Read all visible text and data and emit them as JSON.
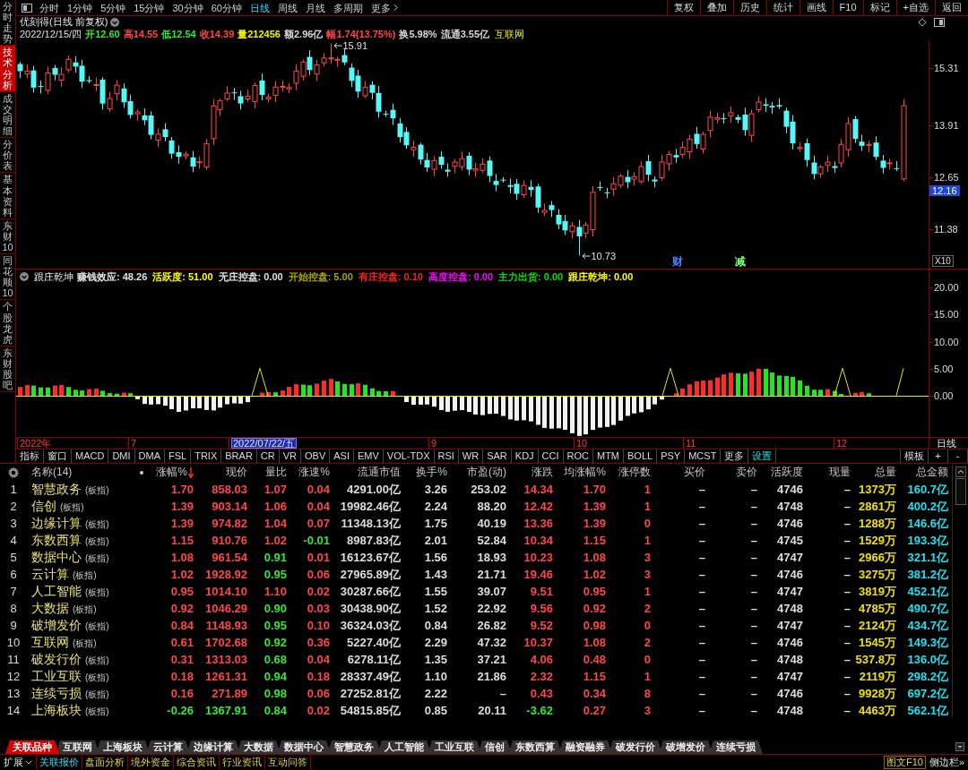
{
  "sidebar": {
    "tabs": [
      {
        "label": "分时走势",
        "selected": false
      },
      {
        "label": "技术分析",
        "selected": true
      },
      {
        "label": "成交明细",
        "selected": false
      },
      {
        "label": "分价表",
        "selected": false
      },
      {
        "label": "基本资料",
        "selected": false
      },
      {
        "label": "东财10",
        "selected": false
      },
      {
        "label": "同花顺10",
        "selected": false
      },
      {
        "label": "个股龙虎",
        "selected": false
      },
      {
        "label": "东财股吧",
        "selected": false
      }
    ]
  },
  "toolbar": {
    "periods": [
      {
        "label": "分时",
        "selected": false
      },
      {
        "label": "1分钟",
        "selected": false
      },
      {
        "label": "5分钟",
        "selected": false
      },
      {
        "label": "15分钟",
        "selected": false
      },
      {
        "label": "30分钟",
        "selected": false
      },
      {
        "label": "60分钟",
        "selected": false
      },
      {
        "label": "日线",
        "selected": true
      },
      {
        "label": "周线",
        "selected": false
      },
      {
        "label": "月线",
        "selected": false
      },
      {
        "label": "多周期",
        "selected": false
      }
    ],
    "more": "更多",
    "actions": [
      "复权",
      "叠加",
      "历史",
      "统计",
      "画线",
      "F10",
      "标记",
      "+自选",
      "返回"
    ]
  },
  "price_chart": {
    "title": "优刻得(日线 前复权)",
    "date": "2022/12/15/四",
    "quote": [
      {
        "text": "开12.60",
        "color": "#33e633"
      },
      {
        "text": "高14.55",
        "color": "#ff4646"
      },
      {
        "text": "低12.54",
        "color": "#33e633"
      },
      {
        "text": "收14.39",
        "color": "#ff4646"
      },
      {
        "text": "量212456",
        "color": "#f2f200"
      },
      {
        "text": "额2.96亿",
        "color": "#d8d8d8"
      },
      {
        "text": "幅1.74(13.75%)",
        "color": "#ff4646"
      },
      {
        "text": "换5.98%",
        "color": "#d8d8d8"
      },
      {
        "text": "流通3.55亿",
        "color": "#d8d8d8"
      }
    ],
    "sector": "互联网",
    "high_label": "15.91",
    "low_label": "10.73",
    "events": [
      {
        "text": "财",
        "color": "#4a86ff"
      },
      {
        "text": "减",
        "color": "#7cff7c"
      }
    ],
    "axis_labels": [
      "15.31",
      "13.91",
      "12.65",
      "11.38"
    ],
    "cursor_price": "12.16",
    "scale": "X10"
  },
  "indicator": {
    "name": "跟庄乾坤",
    "values": [
      {
        "text": "赚钱效应: 48.26",
        "color": "#e0e0e0"
      },
      {
        "text": "活跃度: 51.00",
        "color": "#ffff00"
      },
      {
        "text": "无庄控盘: 0.00",
        "color": "#e0e0e0"
      },
      {
        "text": "开始控盘: 5.00",
        "color": "#a8a800"
      },
      {
        "text": "有庄控盘: 0.10",
        "color": "#ff2020"
      },
      {
        "text": "高度控盘: 0.00",
        "color": "#ff00ff"
      },
      {
        "text": "主力出货: 0.00",
        "color": "#00e000"
      },
      {
        "text": "跟庄乾坤: 0.00",
        "color": "#ffff00"
      }
    ],
    "axis_labels": [
      "20.00",
      "15.00",
      "10.00",
      "5.00",
      "0.00"
    ]
  },
  "date_axis": {
    "labels": [
      {
        "text": "2022年",
        "kind": "tick"
      },
      {
        "text": "7",
        "kind": "tick"
      },
      {
        "text": "2022/07/22/五",
        "kind": "cursor"
      },
      {
        "text": "9",
        "kind": "tick"
      },
      {
        "text": "10",
        "kind": "tick"
      },
      {
        "text": "11",
        "kind": "tick"
      },
      {
        "text": "12",
        "kind": "tick"
      }
    ],
    "period": "日线"
  },
  "indicator_tabs": {
    "tabs": [
      "指标",
      "窗口",
      "MACD",
      "DMI",
      "DMA",
      "FSL",
      "TRIX",
      "BRAR",
      "CR",
      "VR",
      "OBV",
      "ASI",
      "EMV",
      "VOL-TDX",
      "RSI",
      "WR",
      "SAR",
      "KDJ",
      "CCI",
      "ROC",
      "MTM",
      "BOLL",
      "PSY",
      "MCST",
      "更多"
    ],
    "settings": "设置",
    "template": "模板",
    "zoom_in": "+",
    "zoom_out": "-"
  },
  "table": {
    "name_header": "名称(14)",
    "columns": [
      {
        "label": "涨幅%",
        "kind": "signed",
        "sorted": true
      },
      {
        "label": "现价",
        "kind": "signed",
        "sorted": false
      },
      {
        "label": "量比",
        "kind": "signed",
        "sorted": false
      },
      {
        "label": "涨速%",
        "kind": "signed",
        "sorted": false
      },
      {
        "label": "流通市值",
        "kind": "plain",
        "sorted": false
      },
      {
        "label": "换手%",
        "kind": "plain",
        "sorted": false
      },
      {
        "label": "市盈(动)",
        "kind": "plain",
        "sorted": false
      },
      {
        "label": "涨跌",
        "kind": "signed",
        "sorted": false
      },
      {
        "label": "均涨幅%",
        "kind": "signed",
        "sorted": false
      },
      {
        "label": "涨停数",
        "kind": "signed",
        "sorted": false
      },
      {
        "label": "买价",
        "kind": "plain",
        "sorted": false
      },
      {
        "label": "卖价",
        "kind": "plain",
        "sorted": false
      },
      {
        "label": "活跃度",
        "kind": "plain",
        "sorted": false
      },
      {
        "label": "现量",
        "kind": "plain",
        "sorted": false
      },
      {
        "label": "总量",
        "kind": "volume",
        "sorted": false
      },
      {
        "label": "总金额",
        "kind": "amount",
        "sorted": false
      }
    ],
    "rows": [
      {
        "index": "1",
        "name": "智慧政务",
        "tag": "(板指)",
        "cells": [
          {
            "text": "1.70",
            "color": "#ff4646"
          },
          {
            "text": "858.03",
            "color": "#ff4646"
          },
          {
            "text": "1.07",
            "color": "#ff4646"
          },
          {
            "text": "0.04",
            "color": "#ff4646"
          },
          "4291.00亿",
          "3.26",
          "253.02",
          {
            "text": "14.34",
            "color": "#ff4646"
          },
          {
            "text": "1.70",
            "color": "#ff4646"
          },
          {
            "text": "1",
            "color": "#ff4646"
          },
          "–",
          "–",
          "4746",
          "–",
          "1373万",
          "160.7亿"
        ]
      },
      {
        "index": "2",
        "name": "信创",
        "tag": "(板指)",
        "cells": [
          {
            "text": "1.39",
            "color": "#ff4646"
          },
          {
            "text": "903.14",
            "color": "#ff4646"
          },
          {
            "text": "1.06",
            "color": "#ff4646"
          },
          {
            "text": "0.04",
            "color": "#ff4646"
          },
          "19982.46亿",
          "2.24",
          "88.20",
          {
            "text": "12.42",
            "color": "#ff4646"
          },
          {
            "text": "1.39",
            "color": "#ff4646"
          },
          {
            "text": "1",
            "color": "#ff4646"
          },
          "–",
          "–",
          "4748",
          "–",
          "2861万",
          "400.2亿"
        ]
      },
      {
        "index": "3",
        "name": "边缘计算",
        "tag": "(板指)",
        "cells": [
          {
            "text": "1.39",
            "color": "#ff4646"
          },
          {
            "text": "974.82",
            "color": "#ff4646"
          },
          {
            "text": "1.04",
            "color": "#ff4646"
          },
          {
            "text": "0.07",
            "color": "#ff4646"
          },
          "11348.13亿",
          "1.75",
          "40.19",
          {
            "text": "13.36",
            "color": "#ff4646"
          },
          {
            "text": "1.39",
            "color": "#ff4646"
          },
          {
            "text": "0",
            "color": "#ff4646"
          },
          "–",
          "–",
          "4746",
          "–",
          "1288万",
          "146.6亿"
        ]
      },
      {
        "index": "4",
        "name": "东数西算",
        "tag": "(板指)",
        "cells": [
          {
            "text": "1.15",
            "color": "#ff4646"
          },
          {
            "text": "910.76",
            "color": "#ff4646"
          },
          {
            "text": "1.02",
            "color": "#ff4646"
          },
          {
            "text": "-0.01",
            "color": "#33e633"
          },
          "8987.83亿",
          "2.01",
          "52.84",
          {
            "text": "10.34",
            "color": "#ff4646"
          },
          {
            "text": "1.15",
            "color": "#ff4646"
          },
          {
            "text": "1",
            "color": "#ff4646"
          },
          "–",
          "–",
          "4745",
          "–",
          "1529万",
          "193.3亿"
        ]
      },
      {
        "index": "5",
        "name": "数据中心",
        "tag": "(板指)",
        "cells": [
          {
            "text": "1.08",
            "color": "#ff4646"
          },
          {
            "text": "961.54",
            "color": "#ff4646"
          },
          {
            "text": "0.91",
            "color": "#33e633"
          },
          {
            "text": "0.01",
            "color": "#ff4646"
          },
          "16123.67亿",
          "1.56",
          "18.93",
          {
            "text": "10.23",
            "color": "#ff4646"
          },
          {
            "text": "1.08",
            "color": "#ff4646"
          },
          {
            "text": "3",
            "color": "#ff4646"
          },
          "–",
          "–",
          "4747",
          "–",
          "2966万",
          "321.1亿"
        ]
      },
      {
        "index": "6",
        "name": "云计算",
        "tag": "(板指)",
        "cells": [
          {
            "text": "1.02",
            "color": "#ff4646"
          },
          {
            "text": "1928.92",
            "color": "#ff4646"
          },
          {
            "text": "0.95",
            "color": "#33e633"
          },
          {
            "text": "0.06",
            "color": "#ff4646"
          },
          "27965.89亿",
          "1.43",
          "21.71",
          {
            "text": "19.46",
            "color": "#ff4646"
          },
          {
            "text": "1.02",
            "color": "#ff4646"
          },
          {
            "text": "3",
            "color": "#ff4646"
          },
          "–",
          "–",
          "4746",
          "–",
          "3275万",
          "381.2亿"
        ]
      },
      {
        "index": "7",
        "name": "人工智能",
        "tag": "(板指)",
        "cells": [
          {
            "text": "0.95",
            "color": "#ff4646"
          },
          {
            "text": "1014.10",
            "color": "#ff4646"
          },
          {
            "text": "1.10",
            "color": "#ff4646"
          },
          {
            "text": "0.02",
            "color": "#ff4646"
          },
          "30287.66亿",
          "1.55",
          "39.07",
          {
            "text": "9.51",
            "color": "#ff4646"
          },
          {
            "text": "0.95",
            "color": "#ff4646"
          },
          {
            "text": "1",
            "color": "#ff4646"
          },
          "–",
          "–",
          "4747",
          "–",
          "3819万",
          "452.1亿"
        ]
      },
      {
        "index": "8",
        "name": "大数据",
        "tag": "(板指)",
        "cells": [
          {
            "text": "0.92",
            "color": "#ff4646"
          },
          {
            "text": "1046.29",
            "color": "#ff4646"
          },
          {
            "text": "0.90",
            "color": "#33e633"
          },
          {
            "text": "0.03",
            "color": "#ff4646"
          },
          "30438.90亿",
          "1.52",
          "22.92",
          {
            "text": "9.56",
            "color": "#ff4646"
          },
          {
            "text": "0.92",
            "color": "#ff4646"
          },
          {
            "text": "2",
            "color": "#ff4646"
          },
          "–",
          "–",
          "4748",
          "–",
          "4785万",
          "490.7亿"
        ]
      },
      {
        "index": "9",
        "name": "破增发价",
        "tag": "(板指)",
        "cells": [
          {
            "text": "0.84",
            "color": "#ff4646"
          },
          {
            "text": "1148.93",
            "color": "#ff4646"
          },
          {
            "text": "0.95",
            "color": "#33e633"
          },
          {
            "text": "0.10",
            "color": "#ff4646"
          },
          "36324.03亿",
          "0.84",
          "26.82",
          {
            "text": "9.52",
            "color": "#ff4646"
          },
          {
            "text": "0.98",
            "color": "#ff4646"
          },
          {
            "text": "0",
            "color": "#ff4646"
          },
          "–",
          "–",
          "4747",
          "–",
          "2124万",
          "434.7亿"
        ]
      },
      {
        "index": "10",
        "name": "互联网",
        "tag": "(板指)",
        "cells": [
          {
            "text": "0.61",
            "color": "#ff4646"
          },
          {
            "text": "1702.68",
            "color": "#ff4646"
          },
          {
            "text": "0.92",
            "color": "#33e633"
          },
          {
            "text": "0.36",
            "color": "#ff4646"
          },
          "5227.40亿",
          "2.29",
          "47.32",
          {
            "text": "10.37",
            "color": "#ff4646"
          },
          {
            "text": "1.08",
            "color": "#ff4646"
          },
          {
            "text": "2",
            "color": "#ff4646"
          },
          "–",
          "–",
          "4746",
          "–",
          "1545万",
          "149.3亿"
        ]
      },
      {
        "index": "11",
        "name": "破发行价",
        "tag": "(板指)",
        "cells": [
          {
            "text": "0.31",
            "color": "#ff4646"
          },
          {
            "text": "1313.03",
            "color": "#ff4646"
          },
          {
            "text": "0.68",
            "color": "#33e633"
          },
          {
            "text": "0.04",
            "color": "#ff4646"
          },
          "6278.11亿",
          "1.35",
          "37.21",
          {
            "text": "4.06",
            "color": "#ff4646"
          },
          {
            "text": "0.48",
            "color": "#ff4646"
          },
          {
            "text": "0",
            "color": "#ff4646"
          },
          "–",
          "–",
          "4748",
          "–",
          "537.8万",
          "136.0亿"
        ]
      },
      {
        "index": "12",
        "name": "工业互联",
        "tag": "(板指)",
        "cells": [
          {
            "text": "0.18",
            "color": "#ff4646"
          },
          {
            "text": "1261.31",
            "color": "#ff4646"
          },
          {
            "text": "0.94",
            "color": "#33e633"
          },
          {
            "text": "0.18",
            "color": "#ff4646"
          },
          "28337.49亿",
          "1.10",
          "21.86",
          {
            "text": "2.32",
            "color": "#ff4646"
          },
          {
            "text": "1.15",
            "color": "#ff4646"
          },
          {
            "text": "1",
            "color": "#ff4646"
          },
          "–",
          "–",
          "4747",
          "–",
          "2119万",
          "298.2亿"
        ]
      },
      {
        "index": "13",
        "name": "连续亏损",
        "tag": "(板指)",
        "cells": [
          {
            "text": "0.16",
            "color": "#ff4646"
          },
          {
            "text": "271.89",
            "color": "#ff4646"
          },
          {
            "text": "0.98",
            "color": "#33e633"
          },
          {
            "text": "0.06",
            "color": "#ff4646"
          },
          "27252.81亿",
          "2.22",
          "–",
          {
            "text": "0.43",
            "color": "#ff4646"
          },
          {
            "text": "0.34",
            "color": "#ff4646"
          },
          {
            "text": "8",
            "color": "#ff4646"
          },
          "–",
          "–",
          "4746",
          "–",
          "9928万",
          "697.2亿"
        ]
      },
      {
        "index": "14",
        "name": "上海板块",
        "tag": "(板指)",
        "cells": [
          {
            "text": "-0.26",
            "color": "#33e633"
          },
          {
            "text": "1367.91",
            "color": "#33e633"
          },
          {
            "text": "0.84",
            "color": "#33e633"
          },
          {
            "text": "0.02",
            "color": "#ff4646"
          },
          "54815.85亿",
          "0.85",
          "20.11",
          {
            "text": "-3.62",
            "color": "#33e633"
          },
          {
            "text": "0.27",
            "color": "#ff4646"
          },
          {
            "text": "3",
            "color": "#ff4646"
          },
          "–",
          "–",
          "4748",
          "–",
          "4463万",
          "562.1亿"
        ]
      }
    ]
  },
  "bottom_tabs": [
    {
      "label": "关联品种",
      "selected": true
    },
    {
      "label": "互联网",
      "selected": false
    },
    {
      "label": "上海板块",
      "selected": false
    },
    {
      "label": "云计算",
      "selected": false
    },
    {
      "label": "边缘计算",
      "selected": false
    },
    {
      "label": "大数据",
      "selected": false
    },
    {
      "label": "数据中心",
      "selected": false
    },
    {
      "label": "智慧政务",
      "selected": false
    },
    {
      "label": "人工智能",
      "selected": false
    },
    {
      "label": "工业互联",
      "selected": false
    },
    {
      "label": "信创",
      "selected": false
    },
    {
      "label": "东数西算",
      "selected": false
    },
    {
      "label": "融资融券",
      "selected": false
    },
    {
      "label": "破发行价",
      "selected": false
    },
    {
      "label": "破增发价",
      "selected": false
    },
    {
      "label": "连续亏损",
      "selected": false
    }
  ],
  "bottom_bar": {
    "expand": "扩展",
    "links": [
      {
        "label": "关联报价",
        "selected": true
      },
      {
        "label": "盘面分析",
        "selected": false
      },
      {
        "label": "境外资金",
        "selected": false
      },
      {
        "label": "综合资讯",
        "selected": false
      },
      {
        "label": "行业资讯",
        "selected": false
      },
      {
        "label": "互动问答",
        "selected": false
      }
    ],
    "f10": "图文F10",
    "sidebar": "侧边栏»"
  }
}
